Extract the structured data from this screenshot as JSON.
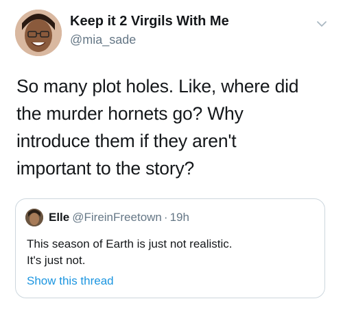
{
  "tweet": {
    "author": {
      "display_name": "Keep it 2 Virgils With Me",
      "handle": "@mia_sade",
      "avatar_icon": "user-avatar"
    },
    "menu_icon": "chevron-down-icon",
    "text": "So many plot holes. Like, where did\nthe murder hornets go? Why\nintroduce them if they aren't\nimportant to the story?"
  },
  "quoted_tweet": {
    "author": {
      "display_name": "Elle",
      "handle": "@FireinFreetown",
      "avatar_icon": "user-avatar"
    },
    "separator": "·",
    "timestamp": "19h",
    "text": "This season of Earth is just not realistic.\nIt's just not.",
    "show_thread_label": "Show this thread"
  },
  "colors": {
    "primary_text": "#14171a",
    "secondary_text": "#657786",
    "link": "#1b95e0",
    "border": "#ccd6dd"
  }
}
